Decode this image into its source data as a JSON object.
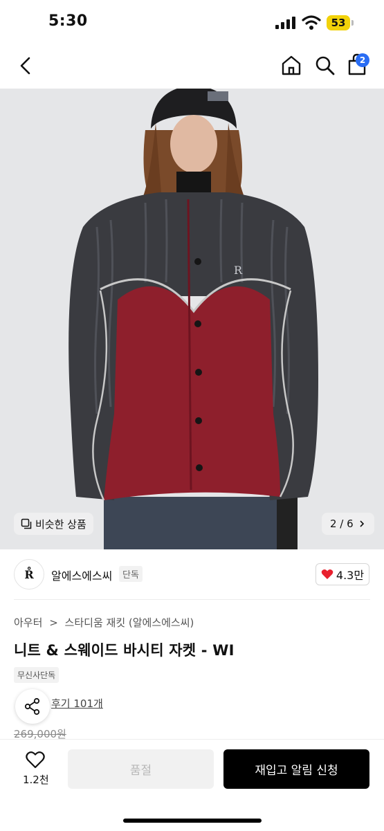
{
  "status_bar": {
    "time": "5:30",
    "battery": "53"
  },
  "nav": {
    "cart_count": "2"
  },
  "hero": {
    "similar_label": "비슷한 상품",
    "page_indicator": "2 / 6"
  },
  "brand": {
    "logo_text": "R̊",
    "name": "알에스에스씨",
    "tag": "단독",
    "likes": "4.3만"
  },
  "product": {
    "breadcrumb_category": "아우터",
    "breadcrumb_sub": "스타디움 재킷 (알에스에스씨)",
    "title": "니트 & 스웨이드 바시티 자켓 - WI",
    "exclusive_badge": "무신사단독",
    "reviews": "후기 101개",
    "original_price": "269,000원"
  },
  "bottom_bar": {
    "wish_count": "1.2천",
    "soldout_label": "품절",
    "restock_label": "재입고 알림 신청"
  },
  "colors": {
    "accent_blue": "#2a6df4",
    "heart_red": "#e8202e",
    "jacket_red": "#8e1f2c",
    "knit_gray": "#3a3b40"
  }
}
